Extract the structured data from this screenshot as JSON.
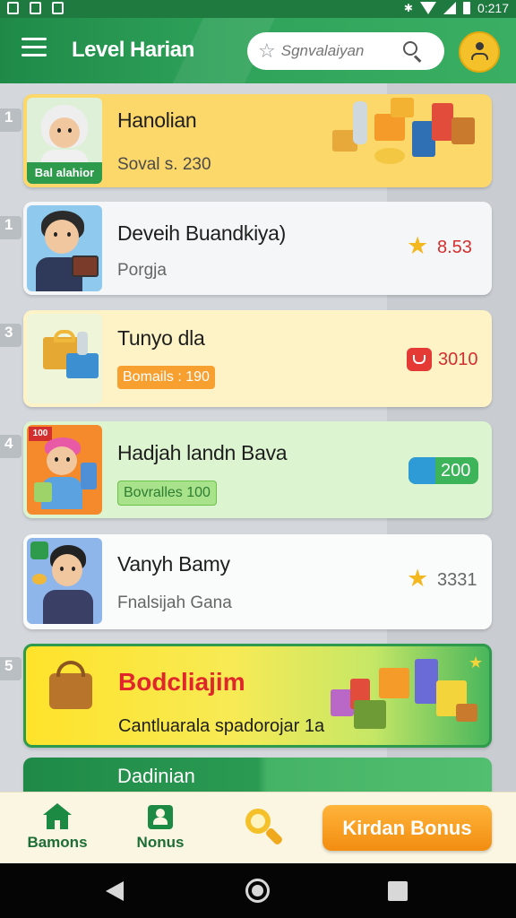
{
  "status_bar": {
    "time": "0:217"
  },
  "app_bar": {
    "title": "Level Harian",
    "search": {
      "placeholder": "Sgnvalaiyan"
    }
  },
  "list": {
    "items": [
      {
        "rank": "1",
        "title": "Hanolian",
        "subtitle": "Soval s. 230",
        "thumb_label": "Bal alahior"
      },
      {
        "rank": "1",
        "title": "Deveih Buandkiya)",
        "subtitle": "Porgja",
        "points": "8.53"
      },
      {
        "rank": "3",
        "title": "Tunyo dla",
        "badge": "Bomails : 190",
        "points": "3010"
      },
      {
        "rank": "4",
        "title": "Hadjah landn Bava",
        "badge": "Bovralles 100",
        "points": "200",
        "thumb_tag": "100"
      },
      {
        "rank": "",
        "title": "Vanyh Bamy",
        "subtitle": "Fnalsijah Gana",
        "points": "3331"
      }
    ],
    "promo": {
      "rank": "5",
      "title": "Bodcliajim",
      "subtitle": "Cantluarala spadorojar 1a"
    },
    "partial": {
      "title": "Dadinian"
    }
  },
  "bottom_nav": {
    "home_label": "Bamons",
    "bonus_label": "Nonus",
    "cta_label": "Kirdan Bonus"
  },
  "colors": {
    "primary": "#1f8a48",
    "accent": "#f5c12a",
    "cta": "#f28d11",
    "points_red": "#d32f2f"
  },
  "icons": [
    "menu-icon",
    "star-icon",
    "search-icon",
    "profile-icon",
    "home-icon",
    "gift-icon",
    "magnifier-icon",
    "back-icon",
    "home-circle-icon",
    "recents-icon"
  ]
}
